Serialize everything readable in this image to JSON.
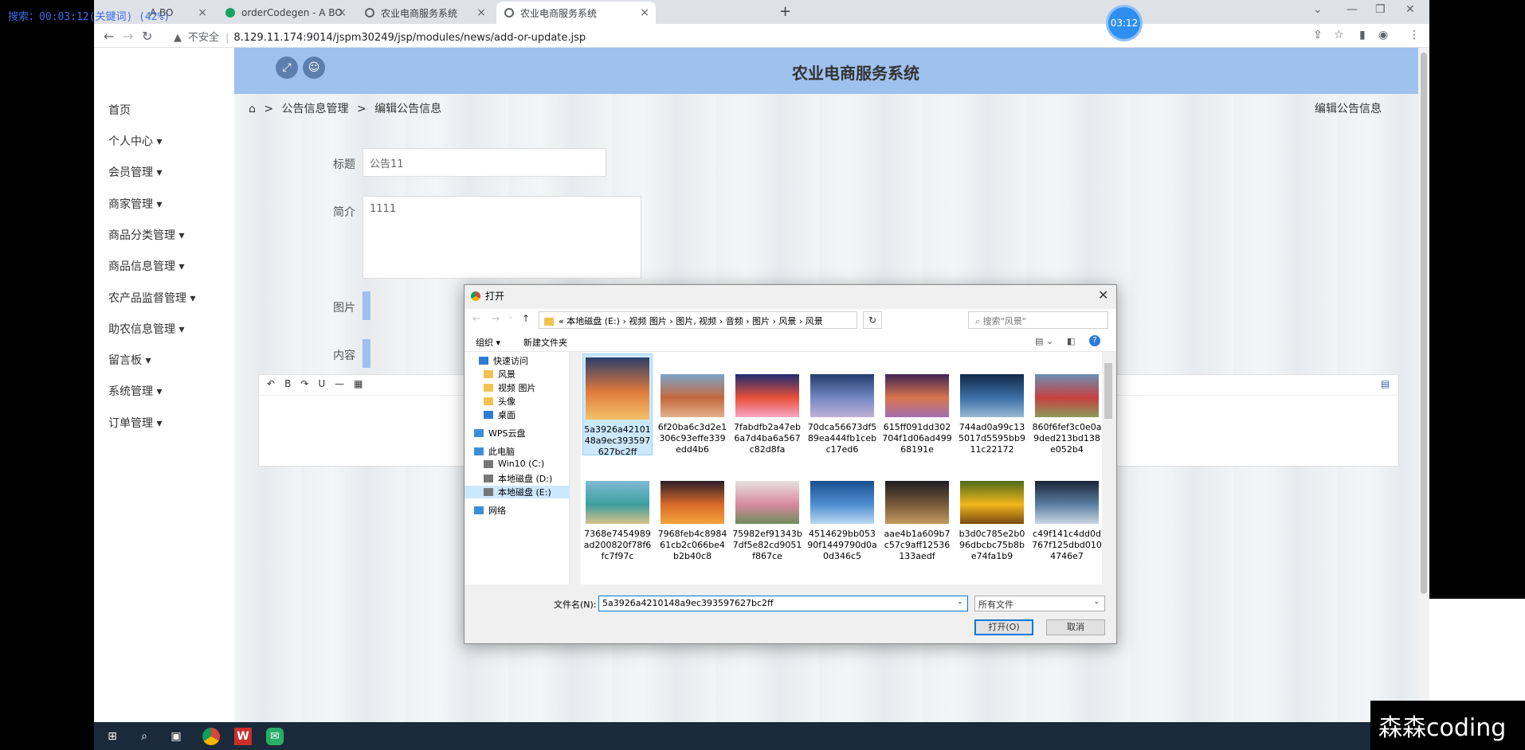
{
  "overlay_text": "搜索：00:03:12(关键词) (42%)",
  "browser": {
    "tabs": [
      {
        "title": "A BO",
        "active": false
      },
      {
        "title": "orderCodegen - A BO",
        "active": false
      },
      {
        "title": "农业电商服务系统",
        "active": false
      },
      {
        "title": "农业电商服务系统",
        "active": true
      }
    ],
    "timer": "03:12",
    "insecure_label": "不安全",
    "url": "8.129.11.174:9014/jspm30249/jsp/modules/news/add-or-update.jsp"
  },
  "app": {
    "system_title": "农业电商服务系统",
    "sidebar_items": [
      "首页",
      "个人中心 ▾",
      "会员管理 ▾",
      "商家管理 ▾",
      "商品分类管理 ▾",
      "商品信息管理 ▾",
      "农产品监督管理 ▾",
      "助农信息管理 ▾",
      "留言板 ▾",
      "系统管理 ▾",
      "订单管理 ▾"
    ],
    "breadcrumb": {
      "home": "⌂",
      "sep": ">",
      "level1": "公告信息管理",
      "level2": "编辑公告信息"
    },
    "breadcrumb_right": "编辑公告信息",
    "form": {
      "title_label": "标题",
      "title_value": "公告11",
      "intro_label": "简介",
      "intro_value": "1111",
      "image_label": "图片",
      "content_label": "内容"
    },
    "editor_toolbar": [
      "↶",
      "B",
      "↷",
      "U",
      "—",
      "▦"
    ]
  },
  "dialog": {
    "title": "打开",
    "path_segments": "«  本地磁盘 (E:)  ›  视频 图片  ›  图片, 视频  ›  音频  ›  图片  ›  风景  ›  风景",
    "search_placeholder": "搜索\"风景\"",
    "organize_label": "组织 ▾",
    "new_folder_label": "新建文件夹",
    "tree": [
      {
        "label": "快速访问",
        "icon": "star-icon",
        "color": "#2e7cd6"
      },
      {
        "label": "风景",
        "icon": "folder-icon",
        "color": "#f1c34e"
      },
      {
        "label": "视频 图片",
        "icon": "folder-icon",
        "color": "#f1c34e"
      },
      {
        "label": "头像",
        "icon": "folder-icon",
        "color": "#f1c34e"
      },
      {
        "label": "桌面",
        "icon": "desktop-icon",
        "color": "#2e7cd6"
      },
      {
        "label": "WPS云盘",
        "icon": "cloud-icon",
        "color": "#3b8fd9"
      },
      {
        "label": "此电脑",
        "icon": "computer-icon",
        "color": "#3b8fd9"
      },
      {
        "label": "Win10 (C:)",
        "icon": "drive-icon",
        "color": "#777"
      },
      {
        "label": "本地磁盘 (D:)",
        "icon": "drive-icon",
        "color": "#777"
      },
      {
        "label": "本地磁盘 (E:)",
        "icon": "drive-icon",
        "color": "#777"
      },
      {
        "label": "网络",
        "icon": "network-icon",
        "color": "#3b8fd9"
      }
    ],
    "files": [
      {
        "name": "5a3926a4210148a9ec393597627bc2ff",
        "colors": [
          "#2c3e6b",
          "#e07a3c",
          "#f3c16a"
        ]
      },
      {
        "name": "6f20ba6c3d2e1306c93effe339edd4b6",
        "colors": [
          "#7aa4c8",
          "#c4693f",
          "#e2b08a"
        ]
      },
      {
        "name": "7fabdfb2a47eb6a7d4ba6a567c82d8fa",
        "colors": [
          "#1e2c72",
          "#e8503a",
          "#f7a6c5"
        ]
      },
      {
        "name": "70dca56673df589ea444fb1cebc17ed6",
        "colors": [
          "#243c6e",
          "#7488c2",
          "#c0b0d8"
        ]
      },
      {
        "name": "615ff091dd302704f1d06ad49968191e",
        "colors": [
          "#402553",
          "#d9744d",
          "#a36fb1"
        ]
      },
      {
        "name": "744ad0a99c135017d5595bb911c22172",
        "colors": [
          "#0f2a4a",
          "#3c6fa8",
          "#9ab8d6"
        ]
      },
      {
        "name": "860f6fef3c0e0a9ded213bd138e052b4",
        "colors": [
          "#6b8fb3",
          "#c74040",
          "#8a9b5a"
        ]
      },
      {
        "name": "7368e7454989ad200820f78f6fc7f97c",
        "colors": [
          "#7fb9d6",
          "#3d9f9e",
          "#d8c08a"
        ]
      },
      {
        "name": "7968feb4c898461cb2c066be4b2b40c8",
        "colors": [
          "#2b1f2a",
          "#d96a2b",
          "#f4a43a"
        ]
      },
      {
        "name": "75982ef91343b7df5e82cd9051f867ce",
        "colors": [
          "#e8e2dc",
          "#d88aa0",
          "#6f8d5a"
        ]
      },
      {
        "name": "4514629bb05390f1449790d0a0d346c5",
        "colors": [
          "#1b4f8e",
          "#4f8ed1",
          "#b9d8f1"
        ]
      },
      {
        "name": "aae4b1a609b7c57c9aff12536133aedf",
        "colors": [
          "#1c1c22",
          "#7a5a3a",
          "#c49a60"
        ]
      },
      {
        "name": "b3d0c785e2b096dbcbc75b8be74fa1b9",
        "colors": [
          "#4f6a1a",
          "#f1b71c",
          "#7a4a10"
        ]
      },
      {
        "name": "c49f141c4dd0d767f125dbd0104746e7",
        "colors": [
          "#1a2638",
          "#5b7ea3",
          "#c9d6e2"
        ]
      },
      {
        "name": "",
        "colors": [
          "#4f9fd6",
          "#a8d4f0",
          "#ffffff"
        ]
      }
    ],
    "filename_label": "文件名(N):",
    "filename_value": "5a3926a4210148a9ec393597627bc2ff",
    "filetype_value": "所有文件",
    "open_label": "打开(O)",
    "cancel_label": "取消"
  },
  "watermark": "森森coding"
}
